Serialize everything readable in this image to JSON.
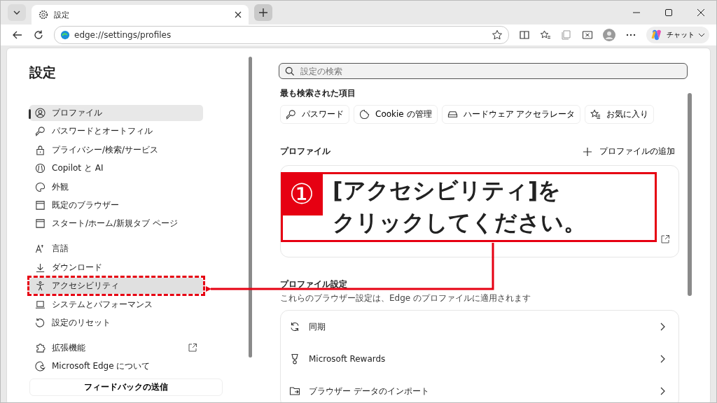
{
  "tab": {
    "title": "設定"
  },
  "address_bar": {
    "url": "edge://settings/profiles"
  },
  "chat_button": {
    "label": "チャット"
  },
  "sidebar": {
    "title": "設定",
    "groups": [
      [
        {
          "label": "プロファイル",
          "selected": true,
          "hovered": false,
          "external": false
        },
        {
          "label": "パスワードとオートフィル",
          "selected": false,
          "hovered": false,
          "external": false
        },
        {
          "label": "プライバシー/検索/サービス",
          "selected": false,
          "hovered": false,
          "external": false
        },
        {
          "label": "Copilot と AI",
          "selected": false,
          "hovered": false,
          "external": false
        },
        {
          "label": "外観",
          "selected": false,
          "hovered": false,
          "external": false
        },
        {
          "label": "既定のブラウザー",
          "selected": false,
          "hovered": false,
          "external": false
        },
        {
          "label": "スタート/ホーム/新規タブ ページ",
          "selected": false,
          "hovered": false,
          "external": false
        }
      ],
      [
        {
          "label": "言語",
          "selected": false,
          "hovered": false,
          "external": false
        },
        {
          "label": "ダウンロード",
          "selected": false,
          "hovered": false,
          "external": false
        },
        {
          "label": "アクセシビリティ",
          "selected": false,
          "hovered": true,
          "external": false
        },
        {
          "label": "システムとパフォーマンス",
          "selected": false,
          "hovered": false,
          "external": false
        },
        {
          "label": "設定のリセット",
          "selected": false,
          "hovered": false,
          "external": false
        }
      ],
      [
        {
          "label": "拡張機能",
          "selected": false,
          "hovered": false,
          "external": true
        },
        {
          "label": "Microsoft Edge について",
          "selected": false,
          "hovered": false,
          "external": false
        }
      ]
    ],
    "feedback_button": "フィードバックの送信"
  },
  "search": {
    "placeholder": "設定の検索"
  },
  "most_searched": {
    "title": "最も検索された項目",
    "chips": [
      "パスワード",
      "Cookie の管理",
      "ハードウェア アクセラレータ",
      "お気に入り"
    ]
  },
  "profiles": {
    "title": "プロファイル",
    "add_button": "プロファイルの追加"
  },
  "profile_settings": {
    "title": "プロファイル設定",
    "description": "これらのブラウザー設定は、Edge のプロファイルに適用されます",
    "rows": [
      "同期",
      "Microsoft Rewards",
      "ブラウザー データのインポート"
    ]
  },
  "callout": {
    "number": "①",
    "lines": [
      "[アクセシビリティ]を",
      "クリックしてください。"
    ]
  }
}
